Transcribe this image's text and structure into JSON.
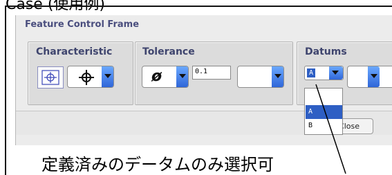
{
  "top_heading": "Case (使用例)",
  "dialog": {
    "title": "Feature Control Frame",
    "groups": {
      "characteristic": {
        "label": "Characteristic",
        "symbol_glyph": "⌖"
      },
      "tolerance": {
        "label": "Tolerance",
        "diameter_glyph": "ø",
        "value": "0.1",
        "secondary_value": ""
      },
      "datums": {
        "label": "Datums",
        "primary_selected": "A",
        "secondary_value": ""
      }
    },
    "close_button_label": "Close"
  },
  "datum_popup": {
    "options": [
      "",
      "A",
      "B"
    ],
    "highlighted_index": 1
  },
  "annotation": "定義済みのデータムのみ選択可",
  "colors": {
    "group_label": "#3f456e",
    "dropdown_arrow": "#2f66d8",
    "popup_highlight": "#2e5fc4"
  }
}
